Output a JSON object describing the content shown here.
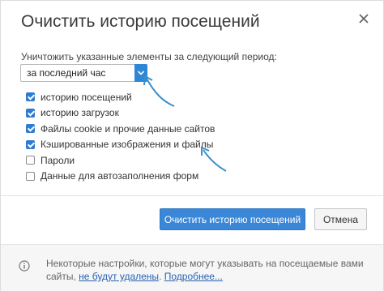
{
  "dialog": {
    "title": "Очистить историю посещений",
    "close_icon": "close-icon"
  },
  "period": {
    "label": "Уничтожить указанные элементы за следующий период:",
    "selected": "за последний час"
  },
  "options": [
    {
      "label": "историю посещений",
      "checked": true
    },
    {
      "label": "историю загрузок",
      "checked": true
    },
    {
      "label": "Файлы cookie и прочие данные сайтов",
      "checked": true
    },
    {
      "label": "Кэшированные изображения и файлы",
      "checked": true
    },
    {
      "label": "Пароли",
      "checked": false
    },
    {
      "label": "Данные для автозаполнения форм",
      "checked": false
    }
  ],
  "buttons": {
    "clear": "Очистить историю посещений",
    "cancel": "Отмена"
  },
  "footer": {
    "text_1": "Некоторые настройки, которые могут указывать на посещаемые вами",
    "text_2": "сайты, ",
    "link_not_deleted": "не будут удалены",
    "text_3": ". ",
    "link_more": "Подробнее...",
    "info_icon": "info-icon"
  },
  "colors": {
    "accent": "#3a87d8",
    "annotation_arrow": "#3b8fc9"
  }
}
